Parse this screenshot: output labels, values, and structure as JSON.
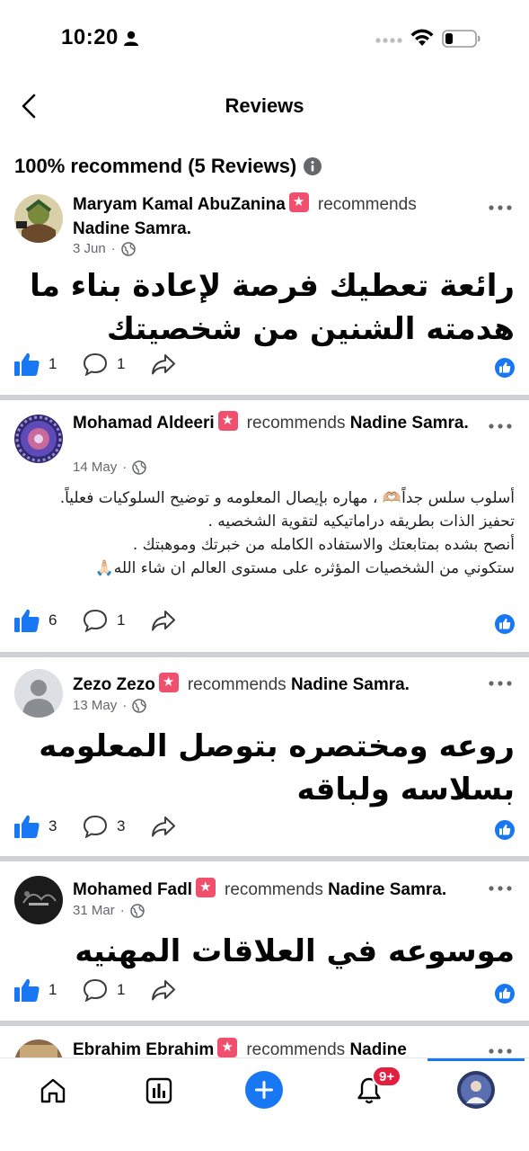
{
  "status_bar": {
    "time": "10:20"
  },
  "header": {
    "title": "Reviews",
    "back_icon": "chevron-left-icon"
  },
  "summary": {
    "text": "100% recommend (5 Reviews)",
    "info_icon": "info-icon"
  },
  "reviews": [
    {
      "author": "Maryam Kamal AbuZanina",
      "recommends": "recommends",
      "target": "Nadine Samra.",
      "date": "3 Jun",
      "sep": "·",
      "body": "رائعة تعطيك فرصة لإعادة بناء ما هدمته الشنين من شخصيتك",
      "likes": "1",
      "comments": "1"
    },
    {
      "author": "Mohamad Aldeeri",
      "recommends": "recommends",
      "target": "Nadine Samra.",
      "date": "14 May",
      "sep": "·",
      "body_lines": [
        "أسلوب سلس جداً🫶🏼 ، مهاره بإيصال المعلومه و توضيح السلوكيات فعلياً.",
        "تحفيز الذات بطريقه دراماتيكيه لتقوية الشخصيه .",
        "أنصح بشده بمتابعتك والاستفاده الكامله من خبرتك وموهبتك .",
        "ستكوني من الشخصيات المؤثره على مستوى العالم ان شاء الله🙏🏻"
      ],
      "likes": "6",
      "comments": "1"
    },
    {
      "author": "Zezo Zezo",
      "recommends": "recommends",
      "target": "Nadine Samra.",
      "date": "13 May",
      "sep": "·",
      "body": "روعه ومختصره بتوصل المعلومه بسلاسه ولباقه",
      "likes": "3",
      "comments": "3"
    },
    {
      "author": "Mohamed Fadl",
      "recommends": "recommends",
      "target": "Nadine Samra.",
      "date": "31 Mar",
      "sep": "·",
      "body": "موسوعه في العلاقات المهنيه",
      "likes": "1",
      "comments": "1"
    },
    {
      "author": "Ebrahim Ebrahim",
      "recommends": "recommends",
      "target": "Nadine"
    }
  ],
  "tabbar": {
    "notif_count": "9+",
    "items": [
      "home-icon",
      "insights-icon",
      "create-icon",
      "notifications-icon",
      "profile-avatar"
    ]
  },
  "colors": {
    "accent": "#1877f2",
    "badge": "#f0506e",
    "notif": "#e41e3f",
    "divider": "#ced0d4"
  }
}
